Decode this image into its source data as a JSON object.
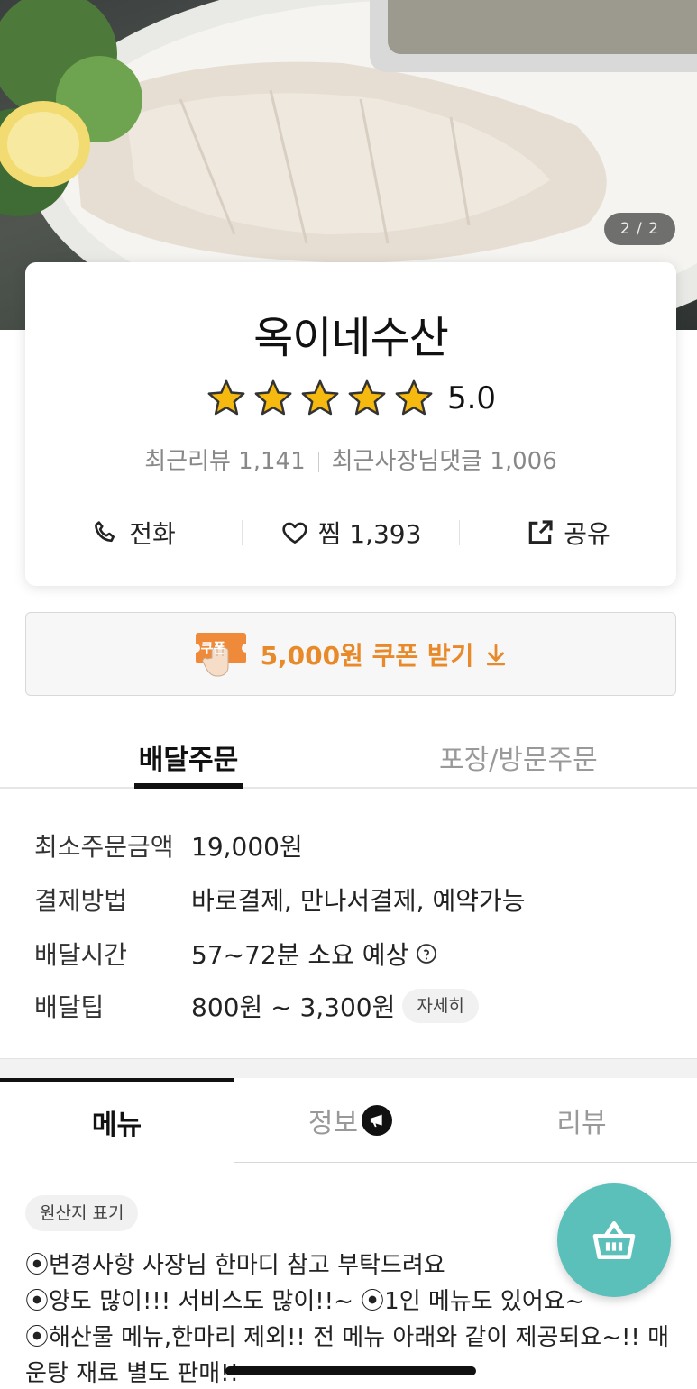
{
  "hero": {
    "page_indicator": "2 / 2"
  },
  "store": {
    "name": "옥이네수산",
    "rating": "5.0",
    "stars": 5,
    "recent_reviews": "최근리뷰 1,141",
    "owner_replies": "최근사장님댓글 1,006",
    "actions": {
      "call": "전화",
      "favorite": "찜 1,393",
      "share": "공유"
    }
  },
  "coupon": {
    "badge": "쿠폰",
    "label": "5,000원 쿠폰 받기",
    "color": "#e8892a"
  },
  "order_tabs": {
    "delivery": "배달주문",
    "pickup": "포장/방문주문"
  },
  "info": {
    "rows": [
      {
        "label": "최소주문금액",
        "value": "19,000원"
      },
      {
        "label": "결제방법",
        "value": "바로결제, 만나서결제, 예약가능"
      },
      {
        "label": "배달시간",
        "value": "57~72분 소요 예상"
      },
      {
        "label": "배달팁",
        "value": "800원 ~ 3,300원"
      }
    ],
    "detail_chip": "자세히"
  },
  "main_tabs": {
    "menu": "메뉴",
    "info": "정보",
    "review": "리뷰"
  },
  "origin_chip": "원산지 표기",
  "notice": [
    "⦿변경사항 사장님 한마디 참고 부탁드려요",
    "⦿양도 많이!!! 서비스도 많이!!~ ⦿1인 메뉴도 있어요~",
    "⦿해산물 메뉴,한마리 제외!! 전 메뉴 아래와 같이 제공되요~!! 매",
    "운탕 재료 별도 판매!!"
  ],
  "colors": {
    "accent": "#5bbfba",
    "star": "#f5b90f",
    "coupon": "#e8892a"
  }
}
